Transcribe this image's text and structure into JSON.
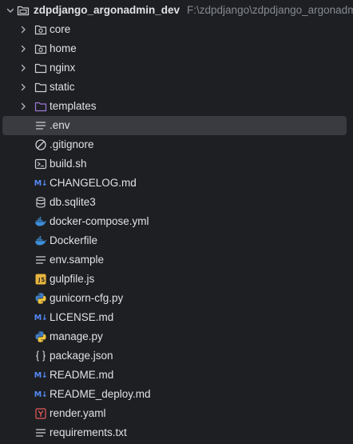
{
  "root": {
    "name": "zdpdjango_argonadmin_dev",
    "path": "F:\\zdpdjango\\zdpdjango_argonadmin_dev"
  },
  "items": [
    {
      "label": "core",
      "kind": "module-folder"
    },
    {
      "label": "home",
      "kind": "module-folder"
    },
    {
      "label": "nginx",
      "kind": "folder"
    },
    {
      "label": "static",
      "kind": "folder"
    },
    {
      "label": "templates",
      "kind": "templates-folder"
    },
    {
      "label": ".env",
      "kind": "text-file",
      "selected": true
    },
    {
      "label": ".gitignore",
      "kind": "ignore-file"
    },
    {
      "label": "build.sh",
      "kind": "shell-file"
    },
    {
      "label": "CHANGELOG.md",
      "kind": "markdown-file"
    },
    {
      "label": "db.sqlite3",
      "kind": "database-file"
    },
    {
      "label": "docker-compose.yml",
      "kind": "docker-file"
    },
    {
      "label": "Dockerfile",
      "kind": "docker-file"
    },
    {
      "label": "env.sample",
      "kind": "text-file"
    },
    {
      "label": "gulpfile.js",
      "kind": "js-file"
    },
    {
      "label": "gunicorn-cfg.py",
      "kind": "python-file"
    },
    {
      "label": "LICENSE.md",
      "kind": "markdown-file"
    },
    {
      "label": "manage.py",
      "kind": "python-file"
    },
    {
      "label": "package.json",
      "kind": "json-file"
    },
    {
      "label": "README.md",
      "kind": "markdown-file"
    },
    {
      "label": "README_deploy.md",
      "kind": "markdown-file"
    },
    {
      "label": "render.yaml",
      "kind": "yaml-file"
    },
    {
      "label": "requirements.txt",
      "kind": "text-file"
    }
  ],
  "colors": {
    "background": "#1e1f22",
    "selection": "#393b40",
    "text": "#dfe1e5",
    "muted": "#868a91",
    "templates_folder": "#9c79d8",
    "markdown": "#548af7",
    "docker": "#3d8fd9",
    "js_badge": "#e8b63e",
    "yaml_badge": "#e55b5b"
  }
}
